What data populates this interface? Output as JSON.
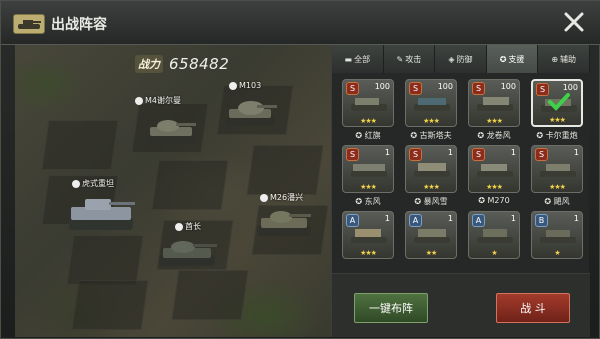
{
  "title": "出战阵容",
  "power": {
    "label": "战力",
    "value": "658482"
  },
  "units": [
    {
      "name": "M4谢尔曼"
    },
    {
      "name": "M103"
    },
    {
      "name": "虎式重坦"
    },
    {
      "name": "M26潘兴"
    },
    {
      "name": "酋长"
    }
  ],
  "tabs": [
    {
      "label": "全部"
    },
    {
      "label": "攻击"
    },
    {
      "label": "防御"
    },
    {
      "label": "支援"
    },
    {
      "label": "辅助"
    }
  ],
  "cards": [
    {
      "label": "红旗",
      "count": "100",
      "stars": "★★★",
      "level": "S"
    },
    {
      "label": "古斯塔夫",
      "count": "100",
      "stars": "★★★",
      "level": "S"
    },
    {
      "label": "龙卷风",
      "count": "100",
      "stars": "★★★",
      "level": "S"
    },
    {
      "label": "卡尔重炮",
      "count": "100",
      "stars": "★★★",
      "level": "S"
    },
    {
      "label": "东风",
      "count": "1",
      "stars": "★★★",
      "level": "S"
    },
    {
      "label": "暴风雪",
      "count": "1",
      "stars": "★★★",
      "level": "S"
    },
    {
      "label": "M270",
      "count": "1",
      "stars": "★★★",
      "level": "S"
    },
    {
      "label": "飓风",
      "count": "1",
      "stars": "★★★",
      "level": "S"
    },
    {
      "label": "",
      "count": "1",
      "stars": "★★★",
      "level": "A"
    },
    {
      "label": "",
      "count": "1",
      "stars": "★★",
      "level": "A"
    },
    {
      "label": "",
      "count": "1",
      "stars": "★",
      "level": "A"
    },
    {
      "label": "",
      "count": "1",
      "stars": "★",
      "level": "B"
    }
  ],
  "buttons": {
    "deploy": "一键布阵",
    "fight": "战 斗"
  }
}
